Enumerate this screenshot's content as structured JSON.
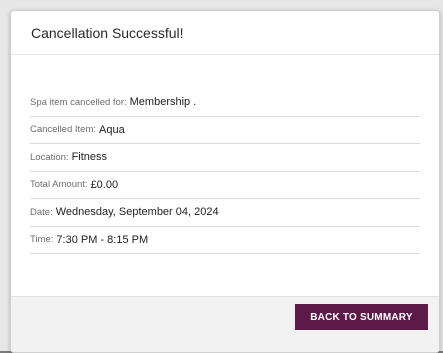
{
  "modal": {
    "title": "Cancellation Successful!",
    "details": [
      {
        "label": "Spa item cancelled for:",
        "value": "Membership ."
      },
      {
        "label": "Cancelled Item:",
        "value": "Aqua"
      },
      {
        "label": "Location:",
        "value": "Fitness"
      },
      {
        "label": "Total Amount:",
        "value": "£0.00"
      },
      {
        "label": "Date:",
        "value": "Wednesday, September 04, 2024"
      },
      {
        "label": "Time:",
        "value": "7:30 PM - 8:15 PM"
      }
    ],
    "footer": {
      "back_label": "BACK TO SUMMARY"
    }
  },
  "colors": {
    "button_bg": "#5b1a47",
    "overlay": "#e7e7e7"
  }
}
